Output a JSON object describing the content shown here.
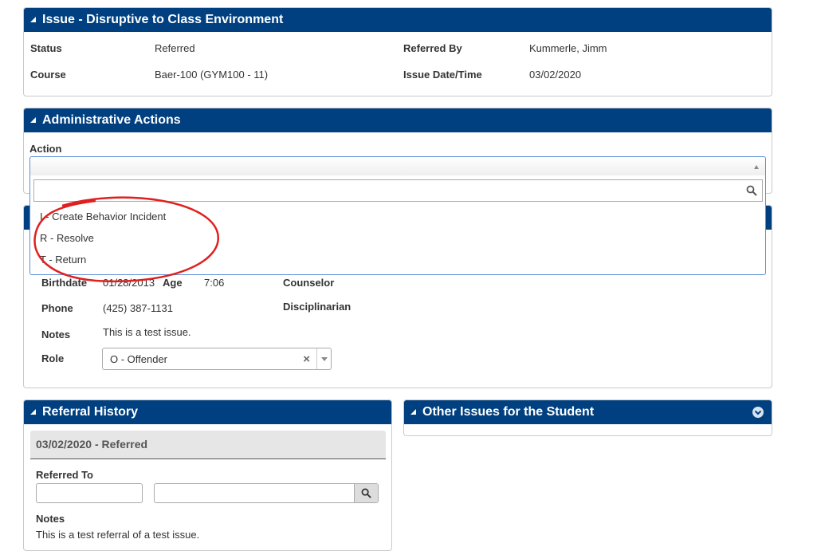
{
  "issue_panel": {
    "title": "Issue - Disruptive to Class Environment",
    "status_label": "Status",
    "status_value": "Referred",
    "referred_by_label": "Referred By",
    "referred_by_value": "Kummerle, Jimm",
    "course_label": "Course",
    "course_value": "Baer-100 (GYM100 - 11)",
    "issue_date_label": "Issue Date/Time",
    "issue_date_value": "03/02/2020"
  },
  "admin_panel": {
    "title": "Administrative Actions",
    "action_label": "Action",
    "action_value": "",
    "search_value": "",
    "options": [
      "I - Create Behavior Incident",
      "R - Resolve",
      "T - Return"
    ]
  },
  "student_panel": {
    "birthdate_label": "Birthdate",
    "birthdate_value": "01/28/2013",
    "age_label": "Age",
    "age_value": "7:06",
    "counselor_label": "Counselor",
    "phone_label": "Phone",
    "phone_value": "(425) 387-1131",
    "disciplinarian_label": "Disciplinarian",
    "notes_label": "Notes",
    "notes_value": "This is a test issue.",
    "role_label": "Role",
    "role_value": "O - Offender",
    "role_clear": "×"
  },
  "referral_history": {
    "title": "Referral History",
    "entry_header": "03/02/2020 - Referred",
    "referred_to_label": "Referred To",
    "referred_to_value_1": "",
    "referred_to_value_2": "",
    "notes_label": "Notes",
    "notes_value": "This is a test referral of a test issue."
  },
  "other_issues": {
    "title": "Other Issues for the Student"
  },
  "colors": {
    "header_bg": "#004080",
    "annotation_red": "#e02020",
    "dropdown_border": "#5b8fd6"
  },
  "icons": [
    "collapse-triangle-icon",
    "search-icon",
    "clear-icon",
    "chevron-down-icon",
    "circle-chevron-down-icon"
  ]
}
